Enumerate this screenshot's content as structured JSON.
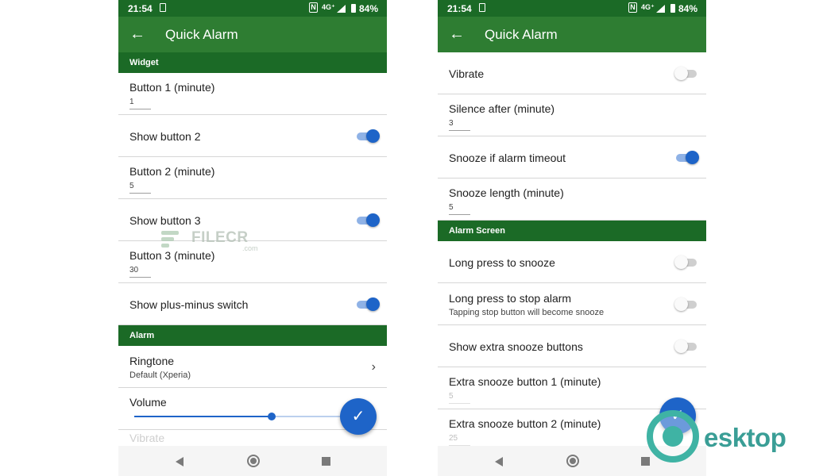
{
  "status_bar": {
    "time": "21:54",
    "network": "4G⁺",
    "battery": "84%"
  },
  "app": {
    "title": "Quick Alarm"
  },
  "left_screen": {
    "widget_header": "Widget",
    "button1": {
      "label": "Button 1 (minute)",
      "value": "1"
    },
    "show_button2": {
      "label": "Show button 2",
      "on": true
    },
    "button2": {
      "label": "Button 2 (minute)",
      "value": "5"
    },
    "show_button3": {
      "label": "Show button 3",
      "on": true
    },
    "button3": {
      "label": "Button 3 (minute)",
      "value": "30"
    },
    "show_plus_minus": {
      "label": "Show plus-minus switch",
      "on": true
    },
    "alarm_header": "Alarm",
    "ringtone": {
      "label": "Ringtone",
      "value": "Default (Xperia)"
    },
    "volume": {
      "label": "Volume",
      "level": 0.66
    },
    "next_item_label": "Vibrate"
  },
  "right_screen": {
    "vibrate": {
      "label": "Vibrate",
      "on": false
    },
    "silence_after": {
      "label": "Silence after (minute)",
      "value": "3"
    },
    "snooze_timeout": {
      "label": "Snooze if alarm timeout",
      "on": true
    },
    "snooze_length": {
      "label": "Snooze length (minute)",
      "value": "5"
    },
    "alarm_screen_header": "Alarm Screen",
    "long_press_snooze": {
      "label": "Long press to snooze",
      "on": false
    },
    "long_press_stop": {
      "label": "Long press to stop alarm",
      "sub": "Tapping stop button will become snooze",
      "on": false
    },
    "extra_snooze": {
      "label": "Show extra snooze buttons",
      "on": false
    },
    "extra_snooze_1": {
      "label": "Extra snooze button 1 (minute)",
      "value": "5"
    },
    "extra_snooze_2": {
      "label": "Extra snooze button 2 (minute)",
      "value": "25"
    }
  },
  "icons": {
    "back": "arrow-left-icon",
    "fab": "check-icon",
    "nav": [
      "nav-back-icon",
      "nav-home-icon",
      "nav-recent-icon"
    ]
  },
  "watermarks": {
    "filecr": "FILECR",
    "filecr_suffix": ".com",
    "desktop": "esktop"
  },
  "colors": {
    "status_bar": "#1b6a26",
    "app_bar": "#2e7d32",
    "section": "#1b6a26",
    "accent": "#1e64c8",
    "background": "#f5f5f5"
  }
}
